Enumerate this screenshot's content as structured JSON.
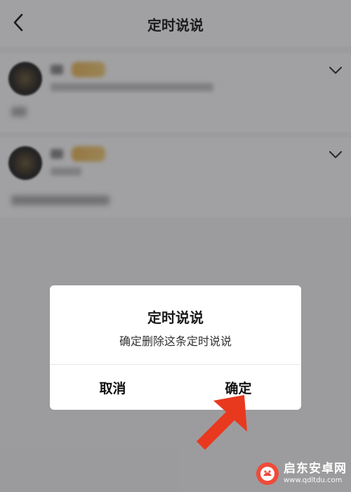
{
  "nav": {
    "title": "定时说说"
  },
  "dialog": {
    "title": "定时说说",
    "message": "确定删除这条定时说说",
    "cancel_label": "取消",
    "confirm_label": "确定"
  },
  "watermark": {
    "brand": "启东安卓网",
    "url": "www.qdltdu.com"
  },
  "icons": {
    "back": "back-arrow-icon",
    "expand": "chevron-down-icon",
    "annotation": "red-arrow-icon",
    "watermark": "brand-logo-icon"
  },
  "colors": {
    "annotation_arrow": "#e8391f",
    "watermark_logo": "#ef4a3a"
  }
}
